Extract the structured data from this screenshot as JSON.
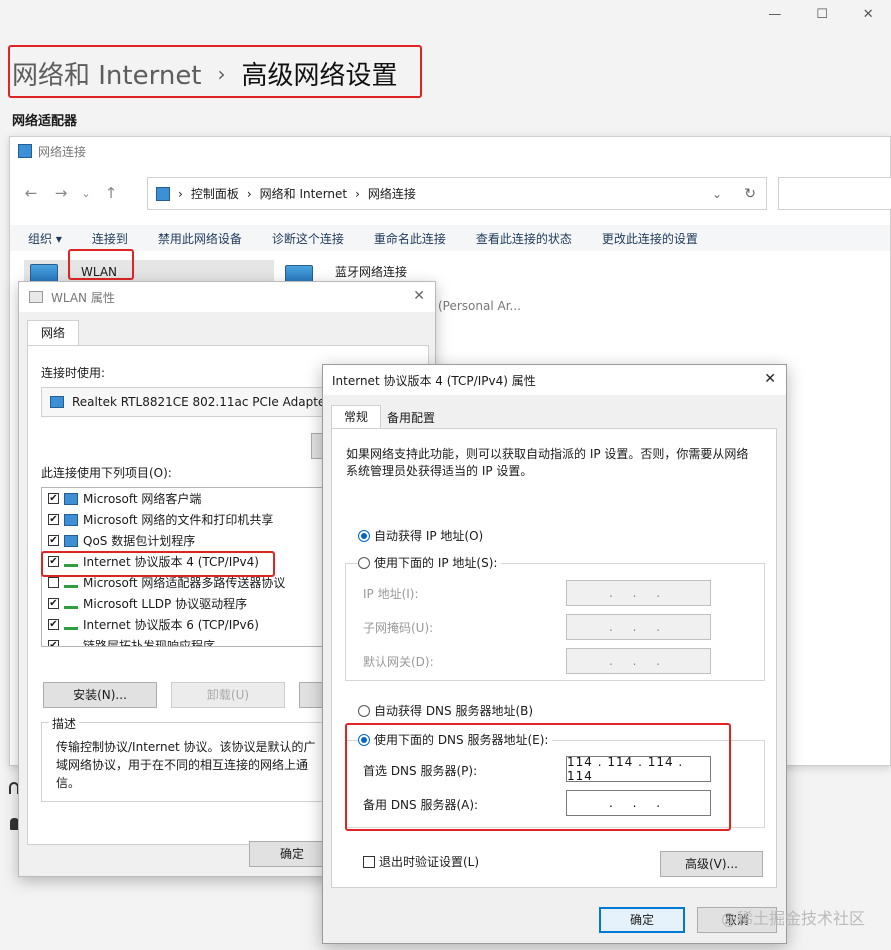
{
  "window_controls": {
    "minimize": "—",
    "maximize": "☐",
    "close": "✕"
  },
  "header": {
    "crumb1": "网络和 Internet",
    "sep": "›",
    "crumb2": "高级网络设置",
    "section": "网络适配器"
  },
  "netconn": {
    "title": "网络连接",
    "nav": {
      "back": "←",
      "forward": "→",
      "recent": "⌄",
      "up": "↑"
    },
    "path": [
      "控制面板",
      "网络和 Internet",
      "网络连接"
    ],
    "path_sep": "›",
    "dropdown": "⌄",
    "refresh": "↻",
    "commands": [
      "组织 ▾",
      "连接到",
      "禁用此网络设备",
      "诊断这个连接",
      "重命名此连接",
      "查看此连接的状态",
      "更改此连接的设置"
    ],
    "wlan_label": "WLAN",
    "bt_label": "蓝牙网络连接",
    "bt_sub": "(Personal Ar..."
  },
  "wlan_props": {
    "title": "WLAN 属性",
    "close": "✕",
    "tab": "网络",
    "connect_using": "连接时使用:",
    "adapter": "Realtek RTL8821CE 802.11ac PCIe Adapter",
    "items_label": "此连接使用下列项目(O):",
    "items": [
      {
        "label": "Microsoft 网络客户端",
        "checked": "✔"
      },
      {
        "label": "Microsoft 网络的文件和打印机共享",
        "checked": "✔"
      },
      {
        "label": "QoS 数据包计划程序",
        "checked": "✔"
      },
      {
        "label": "Internet 协议版本 4 (TCP/IPv4)",
        "checked": "✔"
      },
      {
        "label": "Microsoft 网络适配器多路传送器协议",
        "checked": ""
      },
      {
        "label": "Microsoft LLDP 协议驱动程序",
        "checked": "✔"
      },
      {
        "label": "Internet 协议版本 6 (TCP/IPv6)",
        "checked": "✔"
      },
      {
        "label": "链路层拓扑发现响应程序",
        "checked": "✔"
      }
    ],
    "install_btn": "安装(N)...",
    "uninstall_btn": "卸载(U)",
    "desc_label": "描述",
    "desc_text": "传输控制协议/Internet 协议。该协议是默认的广域网络协议，用于在不同的相互连接的网络上通信。",
    "ok_btn": "确定"
  },
  "ipv4": {
    "title": "Internet 协议版本 4 (TCP/IPv4) 属性",
    "close": "✕",
    "tab_general": "常规",
    "tab_alt": "备用配置",
    "intro": "如果网络支持此功能，则可以获取自动指派的 IP 设置。否则，你需要从网络系统管理员处获得适当的 IP 设置。",
    "auto_ip": "自动获得 IP 地址(O)",
    "manual_ip": "使用下面的 IP 地址(S):",
    "ip_addr": "IP 地址(I):",
    "subnet": "子网掩码(U):",
    "gateway": "默认网关(D):",
    "empty_ip": ". . .",
    "auto_dns": "自动获得 DNS 服务器地址(B)",
    "manual_dns": "使用下面的 DNS 服务器地址(E):",
    "pref_dns_label": "首选 DNS 服务器(P):",
    "pref_dns": "114 . 114 . 114 . 114",
    "alt_dns_label": "备用 DNS 服务器(A):",
    "alt_dns": ". . .",
    "validate": "退出时验证设置(L)",
    "advanced": "高级(V)...",
    "ok": "确定",
    "cancel": "取消"
  },
  "watermark": "@稀土掘金技术社区"
}
